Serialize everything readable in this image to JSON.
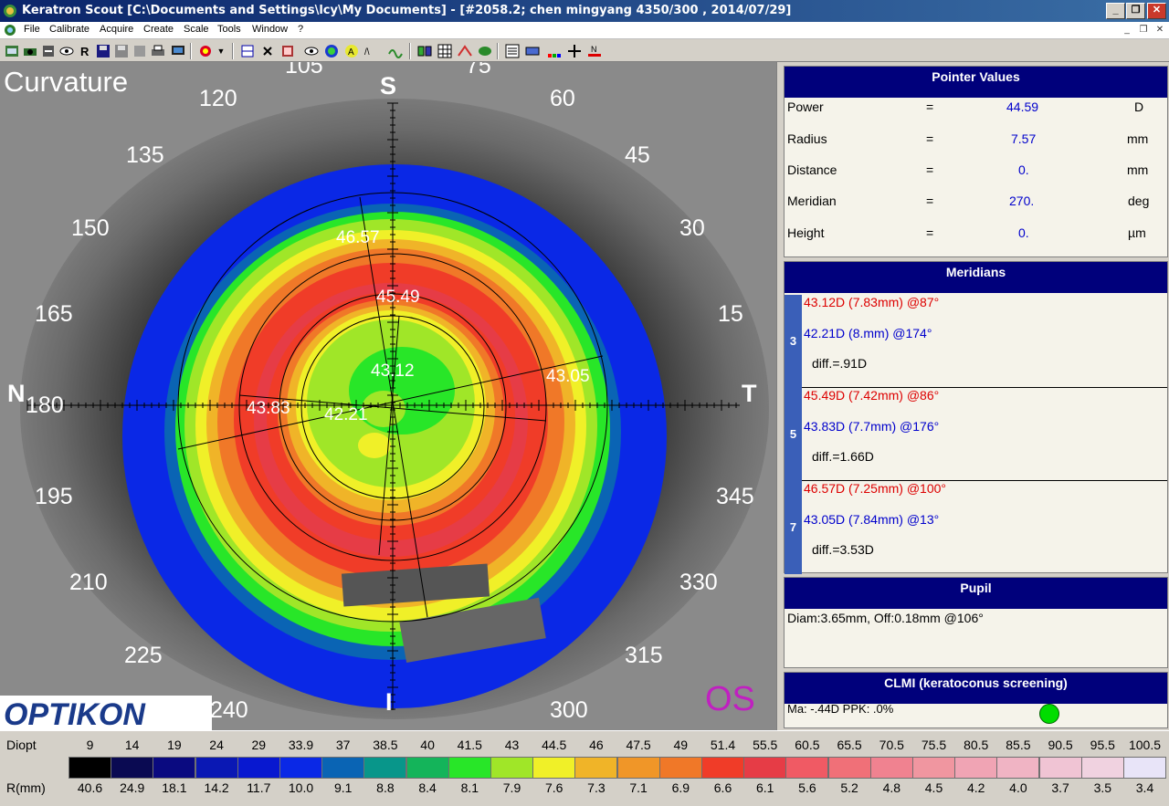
{
  "window": {
    "title": "Keratron Scout [C:\\Documents and Settings\\lcy\\My Documents] - [#2058.2; chen mingyang  4350/300 , 2014/07/29]",
    "min_icon": "minimize-icon",
    "max_icon": "maximize-icon",
    "close_icon": "close-icon"
  },
  "menu": {
    "items": [
      "File",
      "Calibrate",
      "Acquire",
      "Create",
      "Scale",
      "Tools",
      "Window",
      "?"
    ]
  },
  "map": {
    "title": "Curvature",
    "brand": "OPTIKON",
    "eye": "OS",
    "orientation": {
      "top": "S",
      "bottom": "I",
      "left": "N",
      "right": "T"
    },
    "angles": [
      "105",
      "75",
      "120",
      "60",
      "135",
      "45",
      "150",
      "30",
      "165",
      "15",
      "180",
      "195",
      "345",
      "210",
      "330",
      "225",
      "315",
      "240",
      "300"
    ],
    "readings": [
      "46.57",
      "45.49",
      "43.12",
      "43.05",
      "43.83",
      "42.21"
    ]
  },
  "pointer_values": {
    "header": "Pointer Values",
    "rows": [
      {
        "label": "Power",
        "eq": "=",
        "value": "44.59",
        "unit": "D"
      },
      {
        "label": "Radius",
        "eq": "=",
        "value": "7.57",
        "unit": "mm"
      },
      {
        "label": "Distance",
        "eq": "=",
        "value": "0.",
        "unit": "mm"
      },
      {
        "label": "Meridian",
        "eq": "=",
        "value": "270.",
        "unit": "deg"
      },
      {
        "label": "Height",
        "eq": "=",
        "value": "0.",
        "unit": "µm"
      }
    ]
  },
  "meridians": {
    "header": "Meridians",
    "blocks": [
      {
        "num": "3",
        "steep": "43.12D (7.83mm) @87°",
        "flat": "42.21D (8.mm) @174°",
        "diff": "diff.=.91D"
      },
      {
        "num": "5",
        "steep": "45.49D (7.42mm) @86°",
        "flat": "43.83D (7.7mm) @176°",
        "diff": "diff.=1.66D"
      },
      {
        "num": "7",
        "steep": "46.57D (7.25mm) @100°",
        "flat": "43.05D (7.84mm) @13°",
        "diff": "diff.=3.53D"
      }
    ]
  },
  "pupil": {
    "header": "Pupil",
    "text": "Diam:3.65mm, Off:0.18mm @106°"
  },
  "clmi": {
    "header": "CLMI (keratoconus screening)",
    "text": "Ma: -.44D   PPK: .0%",
    "status_color": "#00dd00"
  },
  "legend": {
    "diopt_label": "Diopt",
    "r_label": "R(mm)",
    "diopt": [
      "9",
      "14",
      "19",
      "24",
      "29",
      "33.9",
      "37",
      "38.5",
      "40",
      "41.5",
      "43",
      "44.5",
      "46",
      "47.5",
      "49",
      "51.4",
      "55.5",
      "60.5",
      "65.5",
      "70.5",
      "75.5",
      "80.5",
      "85.5",
      "90.5",
      "95.5",
      "100.5"
    ],
    "r": [
      "40.6",
      "24.9",
      "18.1",
      "14.2",
      "11.7",
      "10.0",
      "9.1",
      "8.8",
      "8.4",
      "8.1",
      "7.9",
      "7.6",
      "7.3",
      "7.1",
      "6.9",
      "6.6",
      "6.1",
      "5.6",
      "5.2",
      "4.8",
      "4.5",
      "4.2",
      "4.0",
      "3.7",
      "3.5",
      "3.4"
    ],
    "colors": [
      "#000000",
      "#0a0a52",
      "#0a0a80",
      "#0a18b4",
      "#0818d0",
      "#0a28e6",
      "#0a64b4",
      "#08968a",
      "#14b45a",
      "#28e628",
      "#a0e628",
      "#f0f028",
      "#f0b428",
      "#f09628",
      "#f07828",
      "#f03c28",
      "#e63c46",
      "#f05a64",
      "#f07078",
      "#f08290",
      "#f096a0",
      "#f0a4b4",
      "#f0b4c4",
      "#f0c4d4",
      "#f0d2e0",
      "#e8e4f8"
    ]
  }
}
